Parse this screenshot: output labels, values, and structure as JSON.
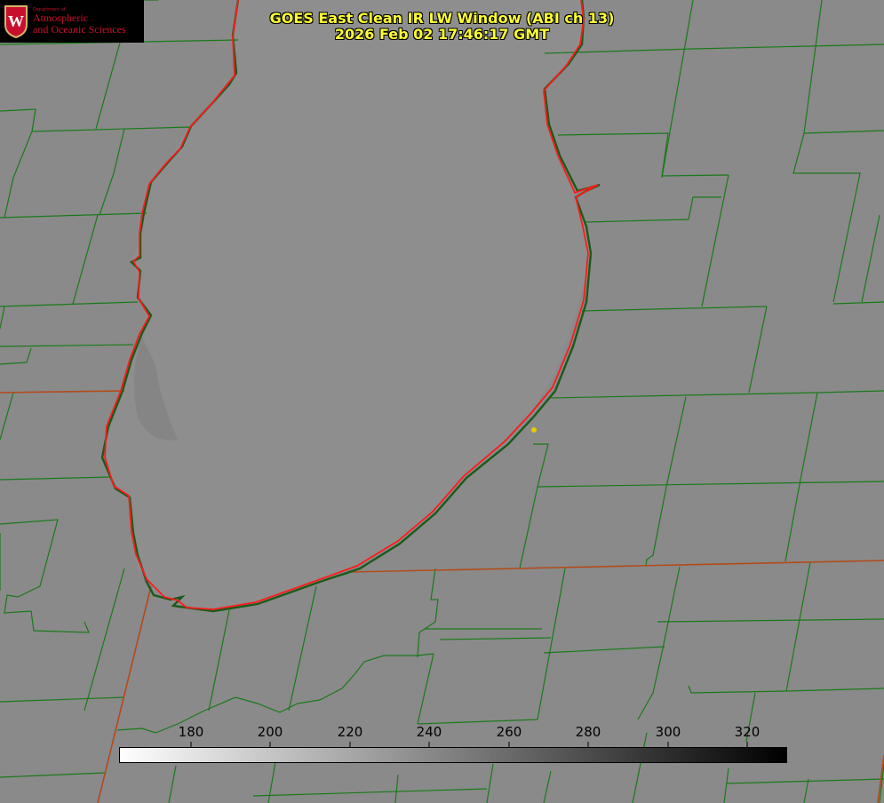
{
  "logo": {
    "small": "Department of",
    "line1": "Atmospheric",
    "line2": "and Oceanic Sciences"
  },
  "title": {
    "line1": "GOES East Clean IR LW Window (ABI ch 13)",
    "line2": "2026 Feb 02 17:46:17 GMT"
  },
  "colorbar": {
    "ticks": [
      "180",
      "200",
      "220",
      "240",
      "260",
      "280",
      "300",
      "320"
    ],
    "gradient_start": "#ffffff",
    "gradient_end": "#000000"
  },
  "colors": {
    "county_lines": "#1a7a1a",
    "coastline": "#ff1a1a",
    "state_line": "#b34a1a",
    "marker": "#e6cc00",
    "background": "#8a8a8a"
  }
}
